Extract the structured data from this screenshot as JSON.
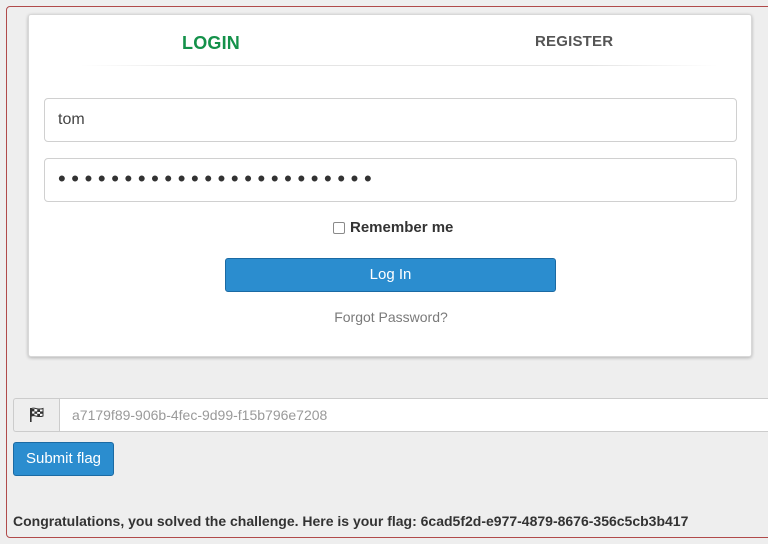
{
  "login_form": {
    "tabs": {
      "login_label": "LOGIN",
      "register_label": "REGISTER"
    },
    "username_value": "tom",
    "password_masked": "••••••••••••••••••••••••",
    "remember_me_label": "Remember me",
    "remember_me_checked": false,
    "login_button_label": "Log In",
    "forgot_password_label": "Forgot Password?"
  },
  "flag_submission": {
    "flag_icon": "checkered-flag-icon",
    "flag_input_value": "a7179f89-906b-4fec-9d99-f15b796e7208",
    "submit_button_label": "Submit flag"
  },
  "result_message": "Congratulations, you solved the challenge. Here is your flag: 6cad5f2d-e977-4879-8676-356c5cb3b417",
  "colors": {
    "active_tab": "#14914a",
    "primary_button": "#2b8dcf",
    "frame_border": "#b04a4a"
  }
}
